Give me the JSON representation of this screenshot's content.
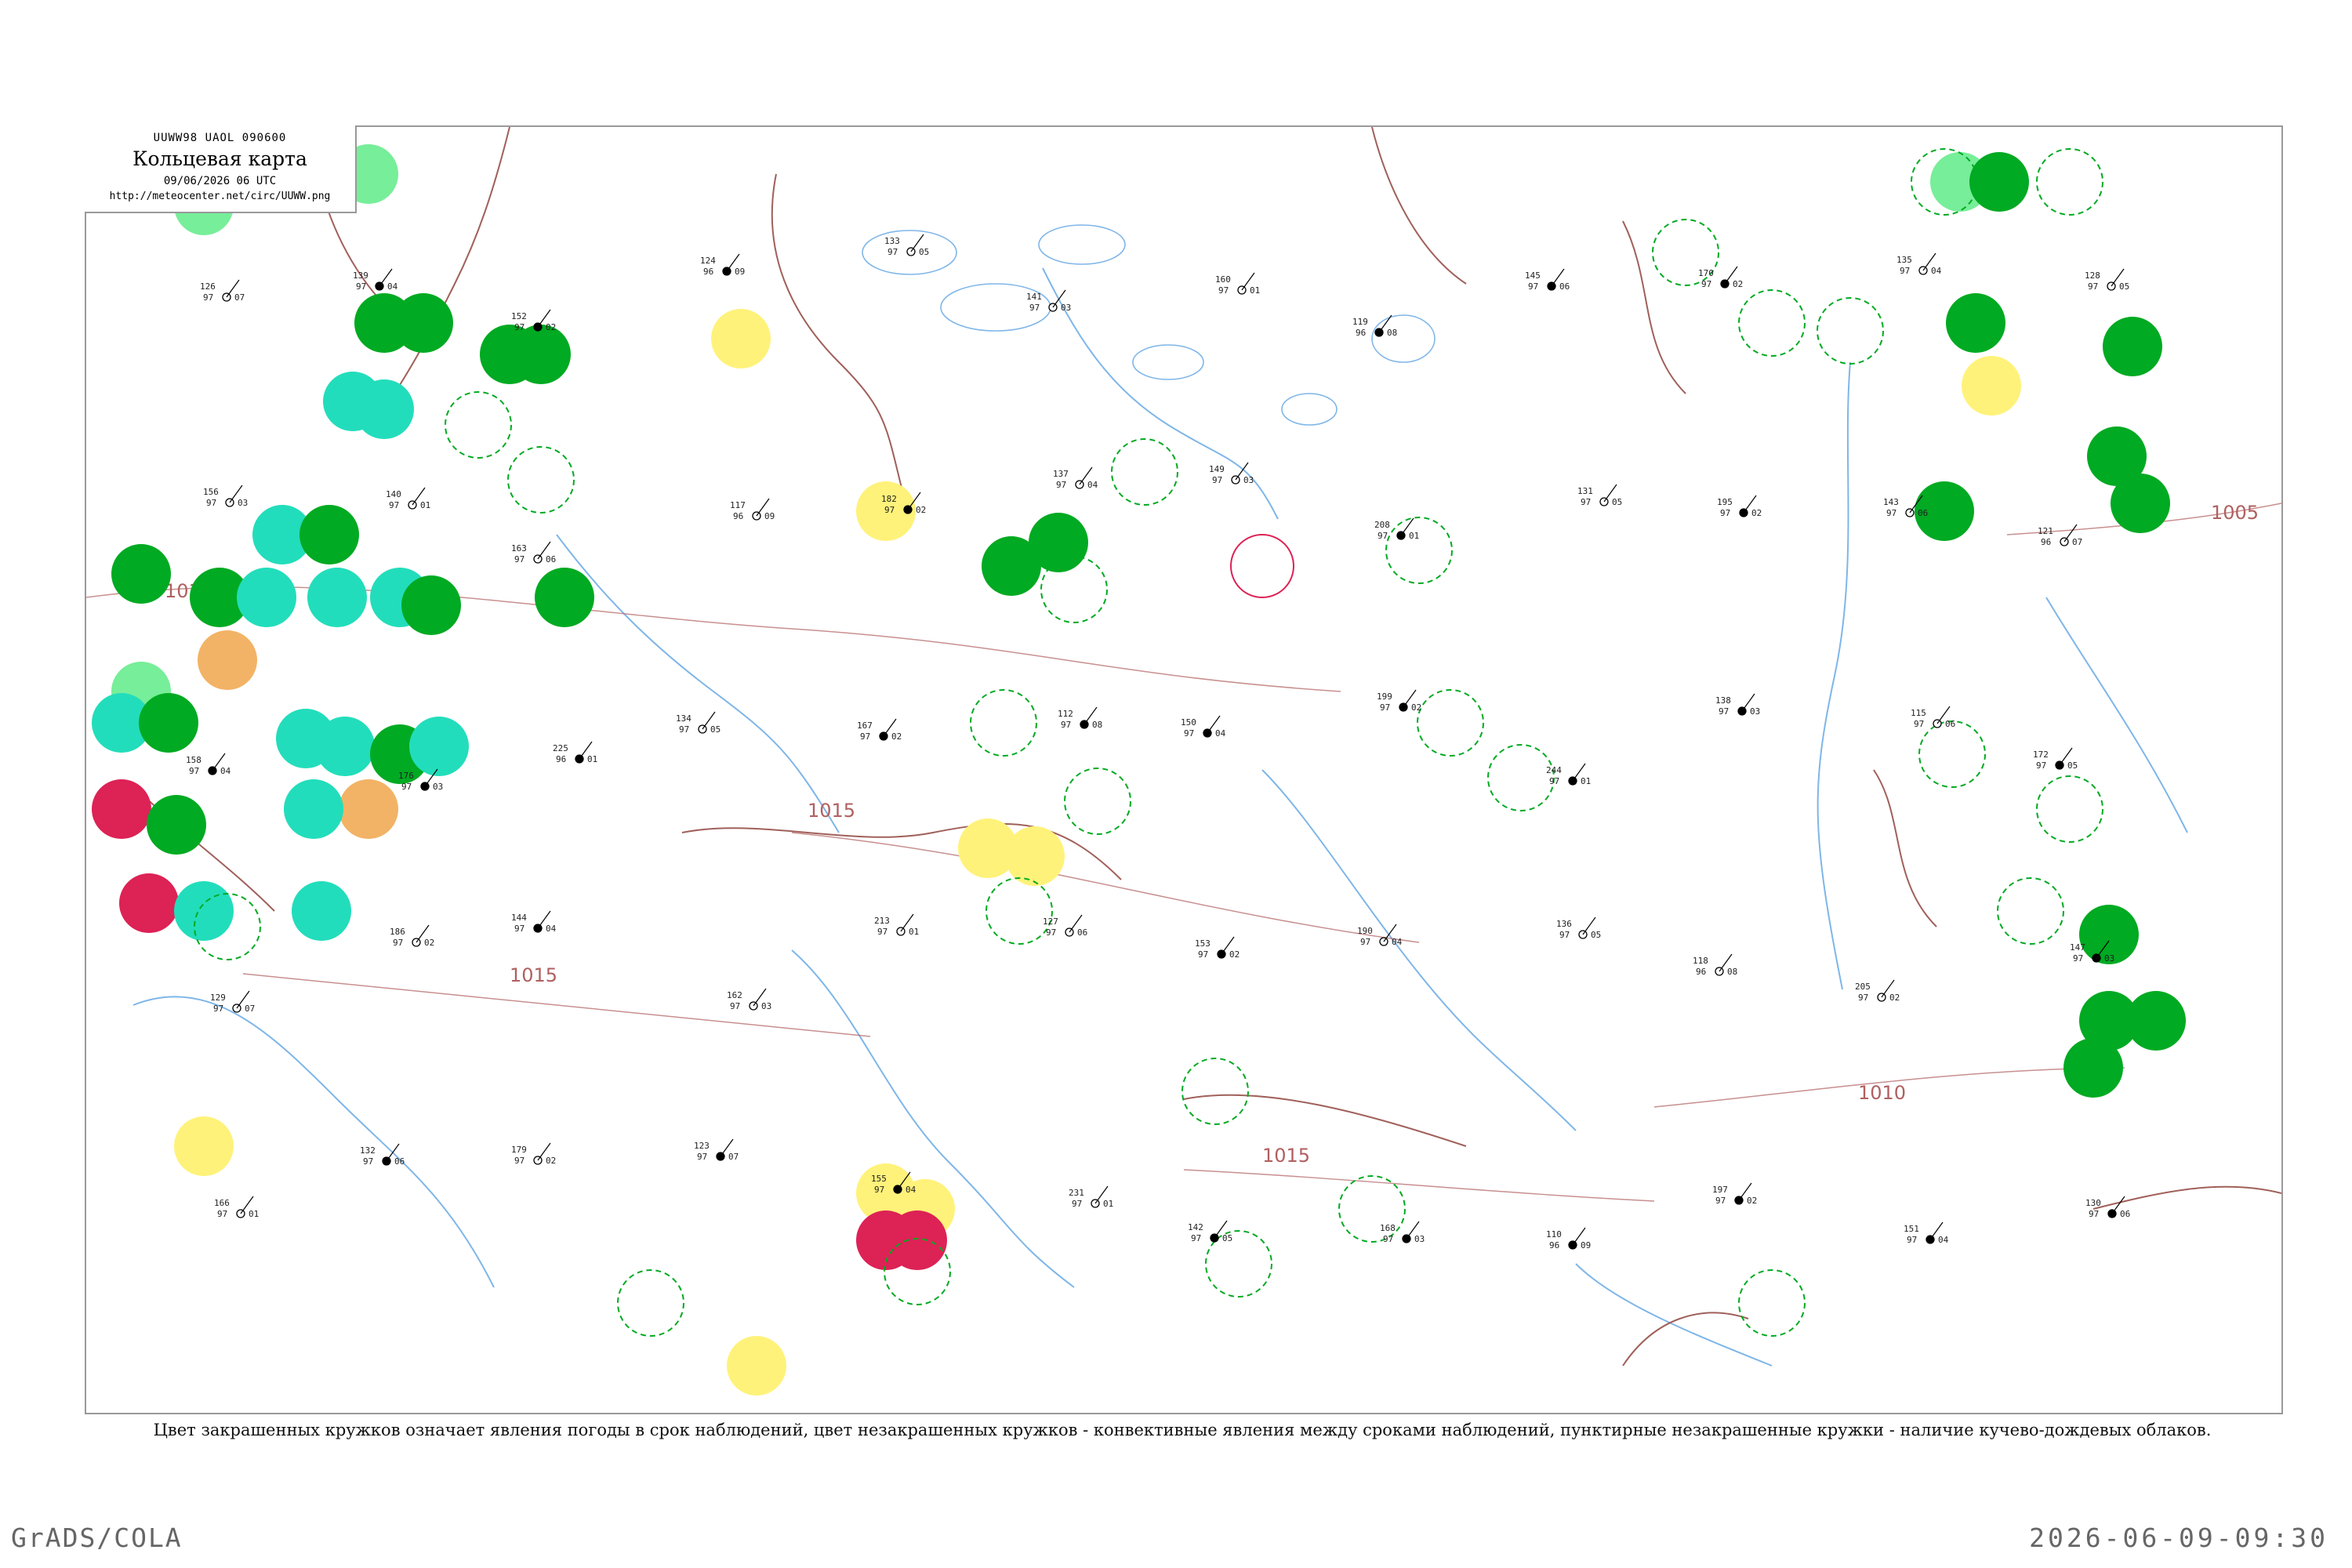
{
  "header": {
    "code_line": "UUWW98  UAOL  090600",
    "title": "Кольцевая карта",
    "datetime": "09/06/2026 06 UTC",
    "url": "http://meteocenter.net/circ/UUWW.png"
  },
  "caption": "Цвет закрашенных кружков означает явления погоды в срок наблюдений, цвет незакрашенных кружков - конвективные явления между сроками наблюдений, пунктирные незакрашенные кружки - наличие кучево-дождевых облаков.",
  "footer": {
    "left": "GrADS/COLA",
    "right": "2026-06-09-09:30"
  },
  "colors": {
    "rain": "#00aa22",
    "shower": "#22ddbb",
    "drizzle": "#77ee99",
    "fog": "#f2b366",
    "haze": "#fff27a",
    "thunder": "#dd2255",
    "isobar": "#b06060",
    "river": "#7fb6e8",
    "border": "#a0605a",
    "frame": "#999999"
  },
  "isobars": [
    {
      "label": "1015"
    },
    {
      "label": "1015"
    },
    {
      "label": "1015"
    },
    {
      "label": "1015"
    },
    {
      "label": "1010"
    },
    {
      "label": "1005"
    }
  ],
  "stations": [
    {
      "t": "126",
      "d": "97",
      "p": "07"
    },
    {
      "t": "139",
      "d": "97",
      "p": "04"
    },
    {
      "t": "152",
      "d": "97",
      "p": "02"
    },
    {
      "t": "124",
      "d": "96",
      "p": "09"
    },
    {
      "t": "133",
      "d": "97",
      "p": "05"
    },
    {
      "t": "141",
      "d": "97",
      "p": "03"
    },
    {
      "t": "160",
      "d": "97",
      "p": "01"
    },
    {
      "t": "119",
      "d": "96",
      "p": "08"
    },
    {
      "t": "145",
      "d": "97",
      "p": "06"
    },
    {
      "t": "170",
      "d": "97",
      "p": "02"
    },
    {
      "t": "135",
      "d": "97",
      "p": "04"
    },
    {
      "t": "128",
      "d": "97",
      "p": "05"
    },
    {
      "t": "156",
      "d": "97",
      "p": "03"
    },
    {
      "t": "140",
      "d": "97",
      "p": "01"
    },
    {
      "t": "163",
      "d": "97",
      "p": "06"
    },
    {
      "t": "117",
      "d": "96",
      "p": "09"
    },
    {
      "t": "182",
      "d": "97",
      "p": "02"
    },
    {
      "t": "137",
      "d": "97",
      "p": "04"
    },
    {
      "t": "149",
      "d": "97",
      "p": "03"
    },
    {
      "t": "208",
      "d": "97",
      "p": "01"
    },
    {
      "t": "131",
      "d": "97",
      "p": "05"
    },
    {
      "t": "195",
      "d": "97",
      "p": "02"
    },
    {
      "t": "143",
      "d": "97",
      "p": "06"
    },
    {
      "t": "121",
      "d": "96",
      "p": "07"
    },
    {
      "t": "158",
      "d": "97",
      "p": "04"
    },
    {
      "t": "176",
      "d": "97",
      "p": "03"
    },
    {
      "t": "225",
      "d": "96",
      "p": "01"
    },
    {
      "t": "134",
      "d": "97",
      "p": "05"
    },
    {
      "t": "167",
      "d": "97",
      "p": "02"
    },
    {
      "t": "112",
      "d": "97",
      "p": "08"
    },
    {
      "t": "150",
      "d": "97",
      "p": "04"
    },
    {
      "t": "199",
      "d": "97",
      "p": "02"
    },
    {
      "t": "244",
      "d": "97",
      "p": "01"
    },
    {
      "t": "138",
      "d": "97",
      "p": "03"
    },
    {
      "t": "115",
      "d": "97",
      "p": "06"
    },
    {
      "t": "172",
      "d": "97",
      "p": "05"
    },
    {
      "t": "129",
      "d": "97",
      "p": "07"
    },
    {
      "t": "186",
      "d": "97",
      "p": "02"
    },
    {
      "t": "144",
      "d": "97",
      "p": "04"
    },
    {
      "t": "162",
      "d": "97",
      "p": "03"
    },
    {
      "t": "213",
      "d": "97",
      "p": "01"
    },
    {
      "t": "127",
      "d": "97",
      "p": "06"
    },
    {
      "t": "153",
      "d": "97",
      "p": "02"
    },
    {
      "t": "190",
      "d": "97",
      "p": "04"
    },
    {
      "t": "136",
      "d": "97",
      "p": "05"
    },
    {
      "t": "118",
      "d": "96",
      "p": "08"
    },
    {
      "t": "205",
      "d": "97",
      "p": "02"
    },
    {
      "t": "147",
      "d": "97",
      "p": "03"
    },
    {
      "t": "166",
      "d": "97",
      "p": "01"
    },
    {
      "t": "132",
      "d": "97",
      "p": "06"
    },
    {
      "t": "179",
      "d": "97",
      "p": "02"
    },
    {
      "t": "123",
      "d": "97",
      "p": "07"
    },
    {
      "t": "155",
      "d": "97",
      "p": "04"
    },
    {
      "t": "231",
      "d": "97",
      "p": "01"
    },
    {
      "t": "142",
      "d": "97",
      "p": "05"
    },
    {
      "t": "168",
      "d": "97",
      "p": "03"
    },
    {
      "t": "110",
      "d": "96",
      "p": "09"
    },
    {
      "t": "197",
      "d": "97",
      "p": "02"
    },
    {
      "t": "151",
      "d": "97",
      "p": "04"
    },
    {
      "t": "130",
      "d": "97",
      "p": "06"
    }
  ]
}
